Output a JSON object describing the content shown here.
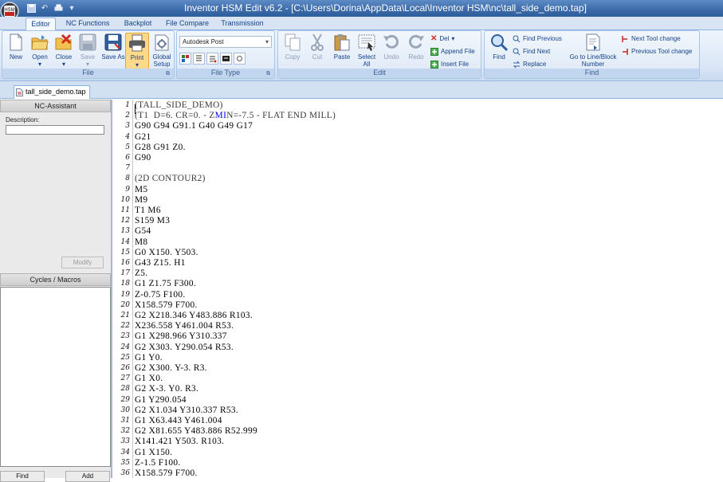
{
  "window": {
    "title": "Inventor HSM Edit v6.2 - [C:\\Users\\Dorina\\AppData\\Local\\Inventor HSM\\nc\\tall_side_demo.tap]"
  },
  "ribbon_tabs": [
    "Editor",
    "NC Functions",
    "Backplot",
    "File Compare",
    "Transmission"
  ],
  "ribbon": {
    "file_group": {
      "label": "File",
      "buttons": [
        "New",
        "Open",
        "Close",
        "Save",
        "Save As",
        "Print",
        "Global Setup"
      ]
    },
    "filetype_group": {
      "label": "File Type",
      "post_select": "Autodesk Post"
    },
    "edit_group": {
      "label": "Edit",
      "buttons": [
        "Copy",
        "Cut",
        "Paste",
        "Select All",
        "Undo",
        "Redo"
      ],
      "small": [
        "Del",
        "Append File",
        "Insert File"
      ]
    },
    "find_group": {
      "label": "Find",
      "find": "Find",
      "small": [
        "Find Previous",
        "Find Next",
        "Replace"
      ],
      "goto": "Go to Line/Block Number",
      "tool": [
        "Next Tool change",
        "Previous Tool change"
      ]
    }
  },
  "document_tab": "tall_side_demo.tap",
  "left_panel": {
    "nc_header": "NC-Assistant",
    "description_label": "Description:",
    "modify": "Modify",
    "cycles_header": "Cycles / Macros",
    "find": "Find",
    "add": "Add"
  },
  "code_lines": [
    "(TALL_SIDE_DEMO)",
    "(T1  D=6. CR=0. - ZMIN=-7.5 - FLAT END MILL)",
    "G90 G94 G91.1 G40 G49 G17",
    "G21",
    "G28 G91 Z0.",
    "G90",
    "",
    "(2D CONTOUR2)",
    "M5",
    "M9",
    "T1 M6",
    "S159 M3",
    "G54",
    "M8",
    "G0 X150. Y503.",
    "G43 Z15. H1",
    "Z5.",
    "G1 Z1.75 F300.",
    "Z-0.75 F100.",
    "X158.579 F700.",
    "G2 X218.346 Y483.886 R103.",
    "X236.558 Y461.004 R53.",
    "G1 X298.966 Y310.337",
    "G2 X303. Y290.054 R53.",
    "G1 Y0.",
    "G2 X300. Y-3. R3.",
    "G1 X0.",
    "G2 X-3. Y0. R3.",
    "G1 Y290.054",
    "G2 X1.034 Y310.337 R53.",
    "G1 X63.443 Y461.004",
    "G2 X81.655 Y483.886 R52.999",
    "X141.421 Y503. R103.",
    "G1 X150.",
    "Z-1.5 F100.",
    "X158.579 F700."
  ]
}
